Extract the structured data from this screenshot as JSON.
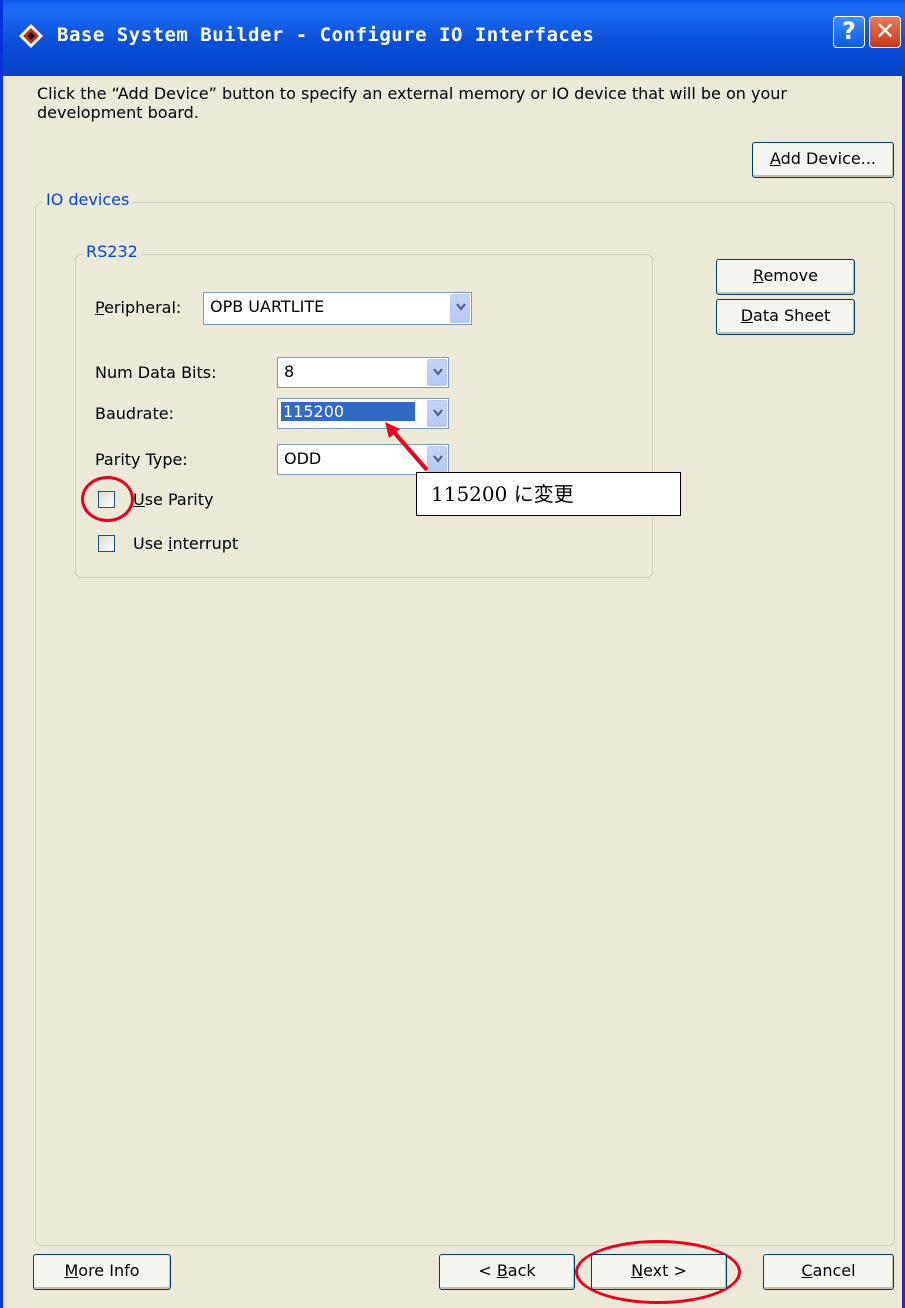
{
  "window": {
    "title": "Base System Builder - Configure IO Interfaces",
    "help_label": "?",
    "close_label": "✕"
  },
  "description": "Click the “Add Device” button to specify an external memory or IO device that will be on your development board.",
  "toolbar": {
    "add_device_mnemonic": "A",
    "add_device_rest": "dd Device..."
  },
  "io_group": {
    "title": "IO devices",
    "remove_mnemonic": "R",
    "remove_rest": "emove",
    "datasheet_mnemonic": "D",
    "datasheet_rest": "ata Sheet"
  },
  "rs232": {
    "title": "RS232",
    "peripheral_mnemonic": "P",
    "peripheral_rest": "eripheral:",
    "peripheral_value": "OPB UARTLITE",
    "num_data_bits_label": "Num Data Bits:",
    "num_data_bits_value": "8",
    "baudrate_label": "Baudrate:",
    "baudrate_value": "115200",
    "parity_type_label": "Parity Type:",
    "parity_type_value": "ODD",
    "use_parity_mnemonic": "U",
    "use_parity_rest": "se Parity",
    "use_parity_checked": false,
    "use_interrupt_prefix": "Use ",
    "use_interrupt_mnemonic": "i",
    "use_interrupt_rest": "nterrupt",
    "use_interrupt_checked": false
  },
  "annotation": {
    "text": "115200 に変更",
    "color": "#e8001c"
  },
  "footer": {
    "more_info_mnemonic": "M",
    "more_info_rest": "ore Info",
    "back_prefix": "< ",
    "back_mnemonic": "B",
    "back_rest": "ack",
    "next_mnemonic": "N",
    "next_rest": "ext >",
    "cancel_mnemonic": "C",
    "cancel_rest": "ancel"
  },
  "colors": {
    "titlebar": "#0a4fd8",
    "dialog_bg": "#ece9d8",
    "group_title": "#0046d5",
    "selection": "#316ac5",
    "highlight_red": "#e8001c"
  }
}
